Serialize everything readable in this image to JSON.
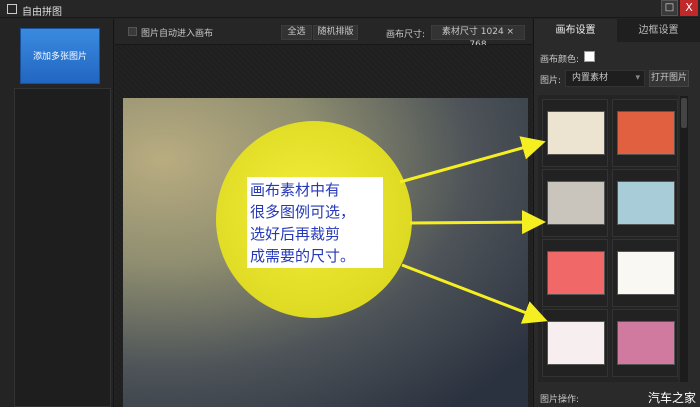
{
  "window": {
    "title": "自由拼图",
    "maximize": "□",
    "close": "X"
  },
  "left": {
    "add_button": "添加多张图片"
  },
  "toolbar": {
    "auto_label": "图片自动进入画布",
    "select_all": "全选",
    "random_layout": "随机排版",
    "canvas_size_label": "画布尺寸:",
    "canvas_size_value": "素材尺寸 1024 × 768"
  },
  "right": {
    "tabs": [
      "画布设置",
      "边框设置"
    ],
    "canvas_color_label": "画布颜色:",
    "canvas_color": "#ffffff",
    "picture_label": "图片:",
    "picture_select": "内置素材",
    "open_button": "打开图片",
    "ops_label": "图片操作:",
    "thumbnails": [
      {
        "color": "#ece3d0"
      },
      {
        "color": "#e0603f"
      },
      {
        "color": "#c9c4bc"
      },
      {
        "color": "#a9cdd8"
      },
      {
        "color": "#f06868"
      },
      {
        "color": "#faf8f2"
      },
      {
        "color": "#f7eef0"
      },
      {
        "color": "#d07aa0"
      }
    ]
  },
  "callout": {
    "text": "画布素材中有\n很多图例可选，\n选好后再裁剪\n成需要的尺寸。"
  },
  "watermark": "汽车之家"
}
